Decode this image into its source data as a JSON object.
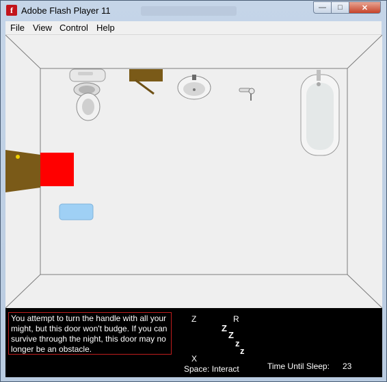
{
  "window": {
    "title": "Adobe Flash Player 11",
    "app_icon_glyph": "f",
    "controls": {
      "minimize_glyph": "—",
      "maximize_glyph": "□",
      "close_glyph": "✕"
    }
  },
  "menu": {
    "items": [
      {
        "label": "File"
      },
      {
        "label": "View"
      },
      {
        "label": "Control"
      },
      {
        "label": "Help"
      }
    ]
  },
  "game": {
    "message": "You attempt to turn the handle with all your might, but this door won't budge. If you can survive through the night, this door may no longer be an obstacle.",
    "keys": {
      "z": "Z",
      "r": "R",
      "x": "X",
      "space": "Space: Interact"
    },
    "zzz_glyphs": [
      "Z",
      "Z",
      "z",
      "z"
    ],
    "timer": {
      "label": "Time Until Sleep:",
      "value": "23"
    },
    "colors": {
      "player": "#ff0000",
      "door": "#7a5a18",
      "towel": "#9fd0f5",
      "hud": "#000000",
      "message_border": "#c01d1d"
    },
    "objects": [
      {
        "name": "toilet"
      },
      {
        "name": "wooden-shelf"
      },
      {
        "name": "sink"
      },
      {
        "name": "hair-dryer"
      },
      {
        "name": "bathtub"
      },
      {
        "name": "door"
      },
      {
        "name": "towel"
      },
      {
        "name": "player"
      }
    ]
  }
}
